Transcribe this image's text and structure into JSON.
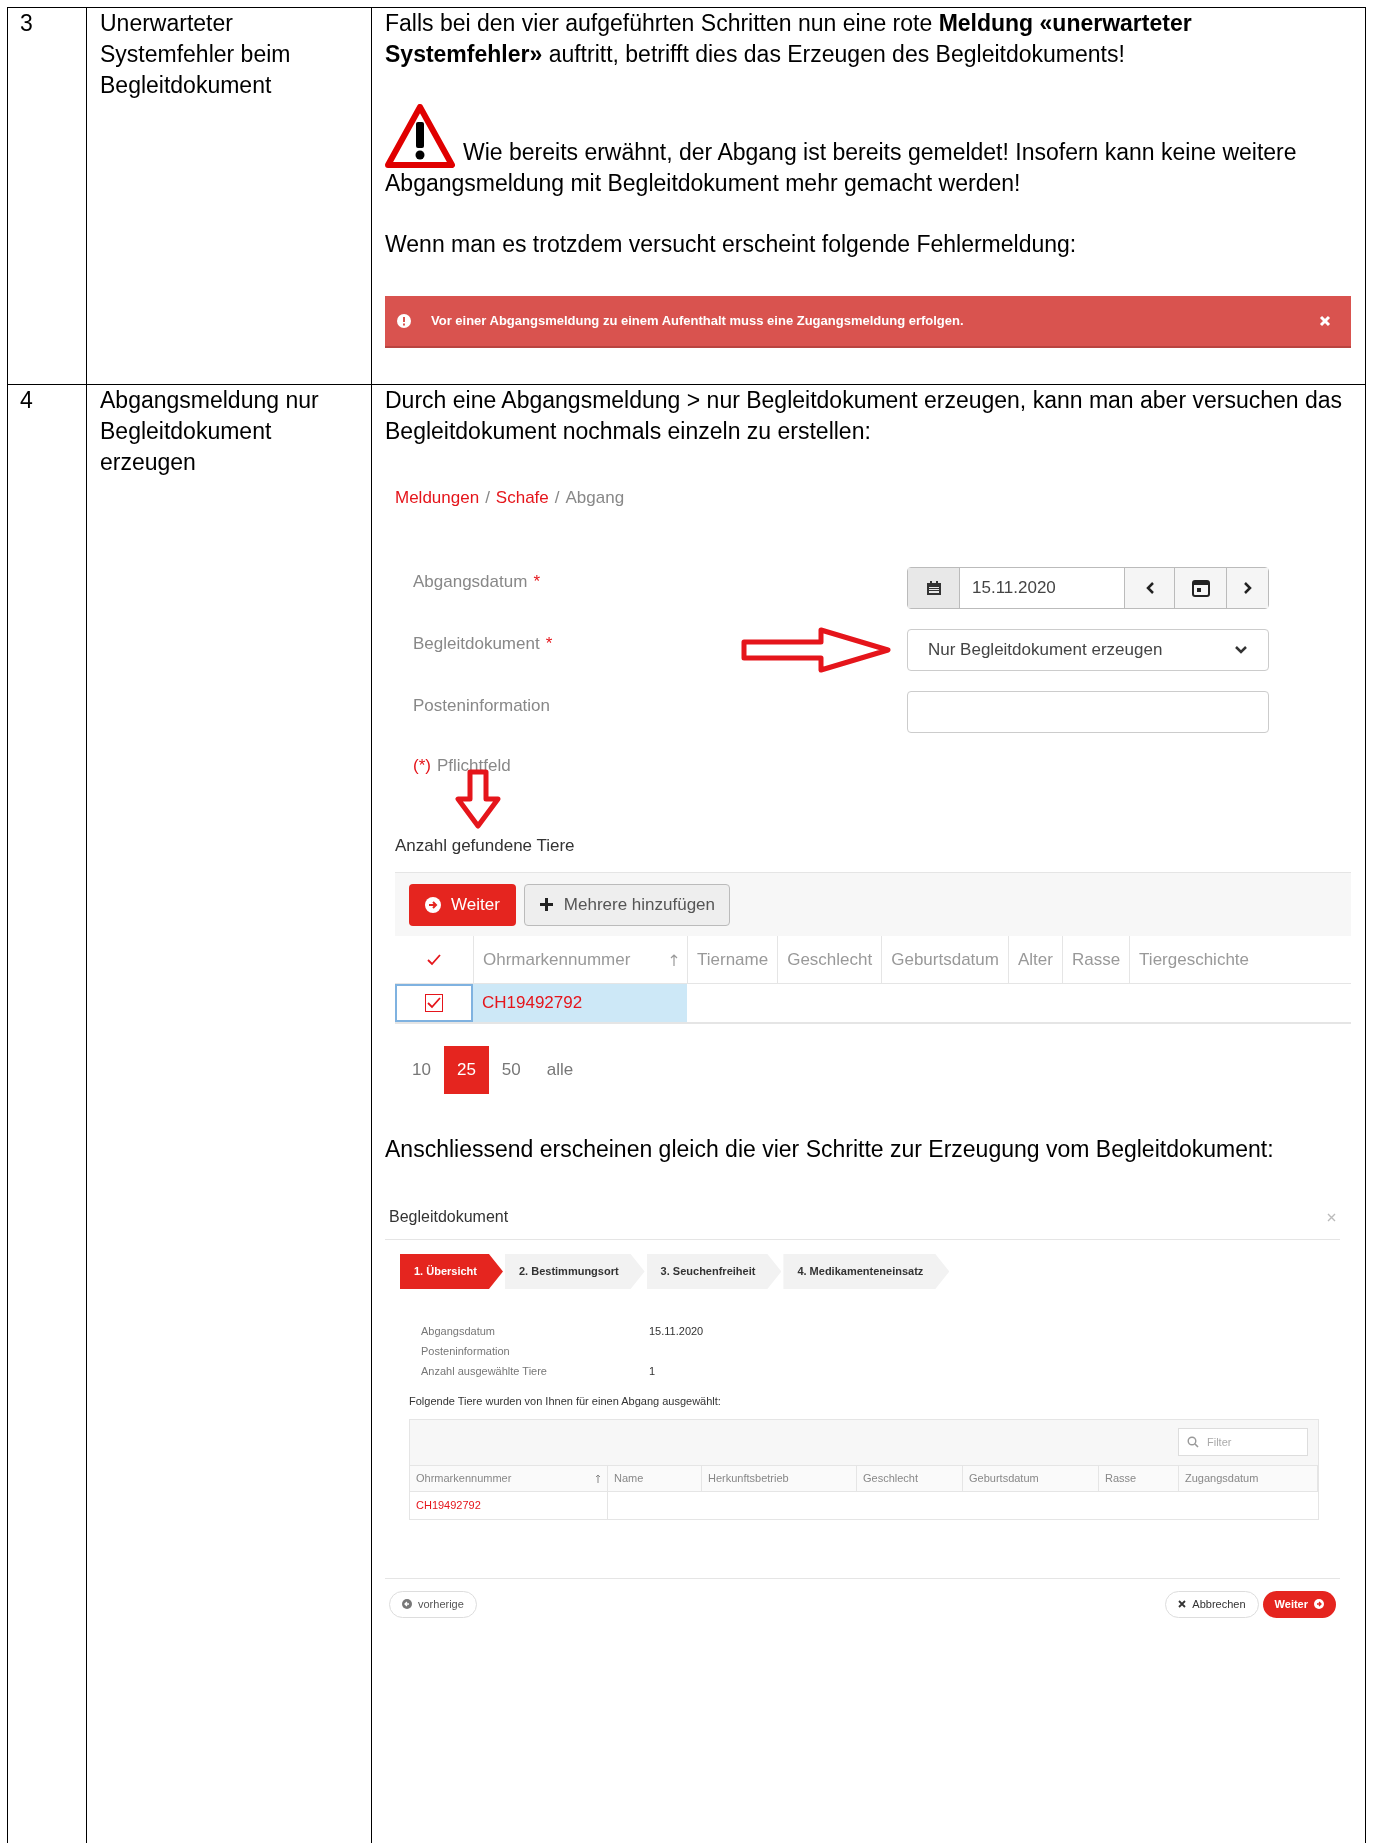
{
  "rows": [
    {
      "number": "3",
      "title": "Unerwarteter Systemfehler beim Begleitdokument",
      "content": [
        {
          "kind": "paragraph",
          "text": "Falls bei den vier aufgeführten Schritten nun eine rote **Meldung «unerwarteter Systemfehler»** auftritt, betrifft dies das Erzeugen des Begleitdokuments!"
        },
        {
          "kind": "warning",
          "text": "Wie bereits erwähnt, der Abgang ist bereits gemeldet! Insofern kann keine weitere Abgangsmeldung mit Begleitdokument mehr gemacht werden!"
        },
        {
          "kind": "paragraph",
          "text": "Wenn man es trotzdem versucht erscheint folgende Fehlermeldung:"
        },
        {
          "kind": "error_alert",
          "text": "Vor einer Abgangsmeldung zu einem Aufenthalt muss eine Zugangsmeldung erfolgen."
        }
      ]
    },
    {
      "number": "4",
      "title": "Abgangsmeldung nur Begleitdokument erzeugen",
      "content": [
        {
          "kind": "paragraph",
          "text": "Durch eine Abgangsmeldung > nur Begleitdokument erzeugen, kann man aber versuchen das Begleitdokument nochmals einzeln zu erstellen:"
        },
        {
          "kind": "form_screenshot",
          "breadcrumb": [
            {
              "label": "Meldungen",
              "link": true,
              "separator": "/"
            },
            {
              "label": "Schafe",
              "link": true,
              "separator": "/"
            },
            {
              "label": "Abgang",
              "link": false
            }
          ],
          "fields": [
            {
              "kind": "date",
              "label": "Abgangsdatum",
              "marker": "*",
              "value": "15.11.2020"
            },
            {
              "kind": "select",
              "label": "Begleitdokument",
              "marker": "*",
              "value": "Nur Begleitdokument erzeugen"
            },
            {
              "kind": "text",
              "label": "Posteninformation"
            }
          ],
          "required_marker": "(*)",
          "required_note": "Pflichtfeld",
          "count_label": "Anzahl gefundene Tiere",
          "buttons": [
            {
              "kind": "primary",
              "label": "Weiter"
            },
            {
              "kind": "default",
              "label": "Mehrere hinzufügen"
            }
          ],
          "header_checked": true,
          "columns": [
            "Ohrmarkennummer",
            "Tiername",
            "Geschlecht",
            "Geburtsdatum",
            "Alter",
            "Rasse",
            "Tiergeschichte"
          ],
          "table_rows": [
            {
              "checked": true,
              "selected": true,
              "ear_tag": "CH19492792"
            }
          ],
          "page_sizes": [
            {
              "label": "10",
              "selected": false
            },
            {
              "label": "25",
              "selected": true
            },
            {
              "label": "50",
              "selected": false
            },
            {
              "label": "alle",
              "selected": false
            }
          ]
        },
        {
          "kind": "paragraph",
          "text": "Anschliessend erscheinen gleich die vier Schritte zur Erzeugung vom Begleitdokument:"
        },
        {
          "kind": "dialog_screenshot",
          "title": "Begleitdokument",
          "steps": [
            {
              "label": "1. Übersicht",
              "selected": true
            },
            {
              "label": "2. Bestimmungsort",
              "selected": false
            },
            {
              "label": "3. Seuchenfreiheit",
              "selected": false
            },
            {
              "label": "4. Medikamenteneinsatz",
              "selected": false
            }
          ],
          "summary": [
            {
              "label": "Abgangsdatum",
              "value": "15.11.2020"
            },
            {
              "label": "Posteninformation"
            },
            {
              "label": "Anzahl ausgewählte Tiere",
              "value": "1"
            }
          ],
          "intro": "Folgende Tiere wurden von Ihnen für einen Abgang ausgewählt:",
          "filter_placeholder": "Filter",
          "columns": [
            "Ohrmarkennummer",
            "Name",
            "Herkunftsbetrieb",
            "Geschlecht",
            "Geburtsdatum",
            "Rasse",
            "Zugangsdatum"
          ],
          "table_rows": [
            {
              "ear_tag": "CH19492792"
            }
          ],
          "back_button": "vorherige",
          "cancel_button": "Abbrechen",
          "next_button": "Weiter"
        }
      ]
    }
  ]
}
